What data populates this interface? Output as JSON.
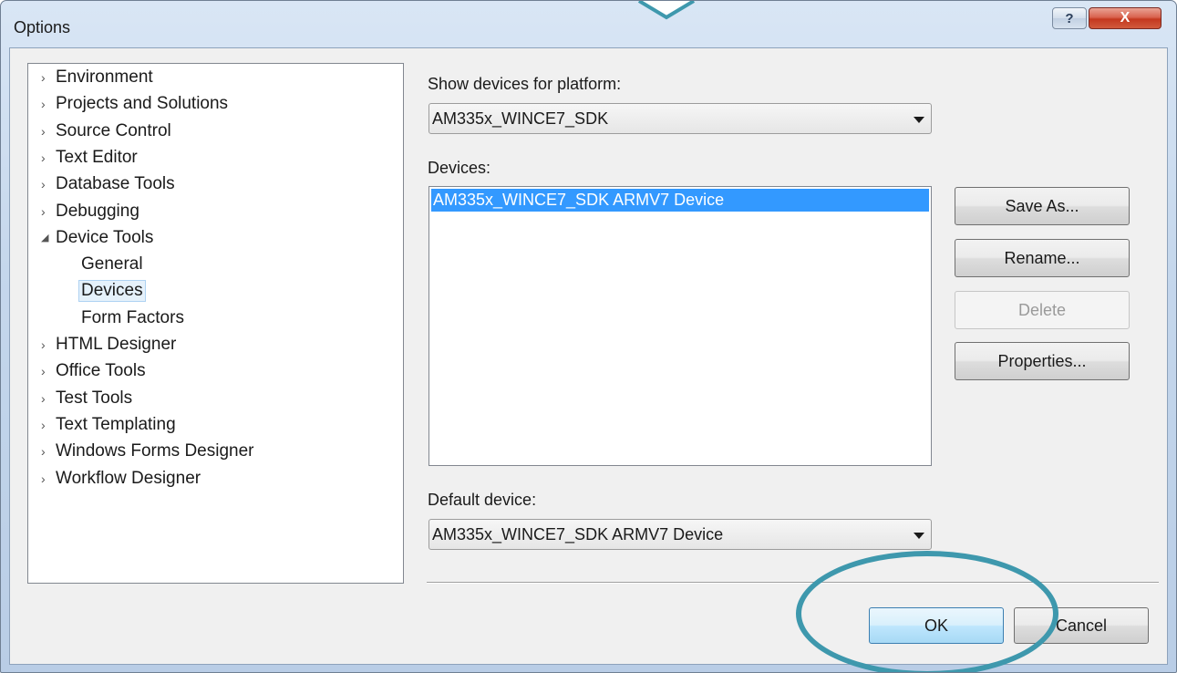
{
  "window": {
    "title": "Options",
    "help_label": "?",
    "close_label": "X"
  },
  "tree": {
    "items": [
      {
        "label": "Environment",
        "arrow": "›",
        "indent": 0
      },
      {
        "label": "Projects and Solutions",
        "arrow": "›",
        "indent": 0
      },
      {
        "label": "Source Control",
        "arrow": "›",
        "indent": 0
      },
      {
        "label": "Text Editor",
        "arrow": "›",
        "indent": 0
      },
      {
        "label": "Database Tools",
        "arrow": "›",
        "indent": 0
      },
      {
        "label": "Debugging",
        "arrow": "›",
        "indent": 0
      },
      {
        "label": "Device Tools",
        "arrow": "◢",
        "indent": 0
      },
      {
        "label": "General",
        "arrow": "",
        "indent": 1
      },
      {
        "label": "Devices",
        "arrow": "",
        "indent": 1,
        "selected": true
      },
      {
        "label": "Form Factors",
        "arrow": "",
        "indent": 1
      },
      {
        "label": "HTML Designer",
        "arrow": "›",
        "indent": 0
      },
      {
        "label": "Office Tools",
        "arrow": "›",
        "indent": 0
      },
      {
        "label": "Test Tools",
        "arrow": "›",
        "indent": 0
      },
      {
        "label": "Text Templating",
        "arrow": "›",
        "indent": 0
      },
      {
        "label": "Windows Forms Designer",
        "arrow": "›",
        "indent": 0
      },
      {
        "label": "Workflow Designer",
        "arrow": "›",
        "indent": 0
      }
    ]
  },
  "platform": {
    "label": "Show devices for platform:",
    "selected": "AM335x_WINCE7_SDK"
  },
  "devices": {
    "label": "Devices:",
    "items": [
      "AM335x_WINCE7_SDK ARMV7 Device"
    ]
  },
  "buttons": {
    "save_as": "Save As...",
    "rename": "Rename...",
    "delete": "Delete",
    "properties": "Properties..."
  },
  "default_device": {
    "label": "Default device:",
    "selected": "AM335x_WINCE7_SDK ARMV7 Device"
  },
  "footer": {
    "ok": "OK",
    "cancel": "Cancel"
  },
  "colors": {
    "selection": "#3399ff",
    "callout": "#3e98ad",
    "close": "#c4381f"
  }
}
